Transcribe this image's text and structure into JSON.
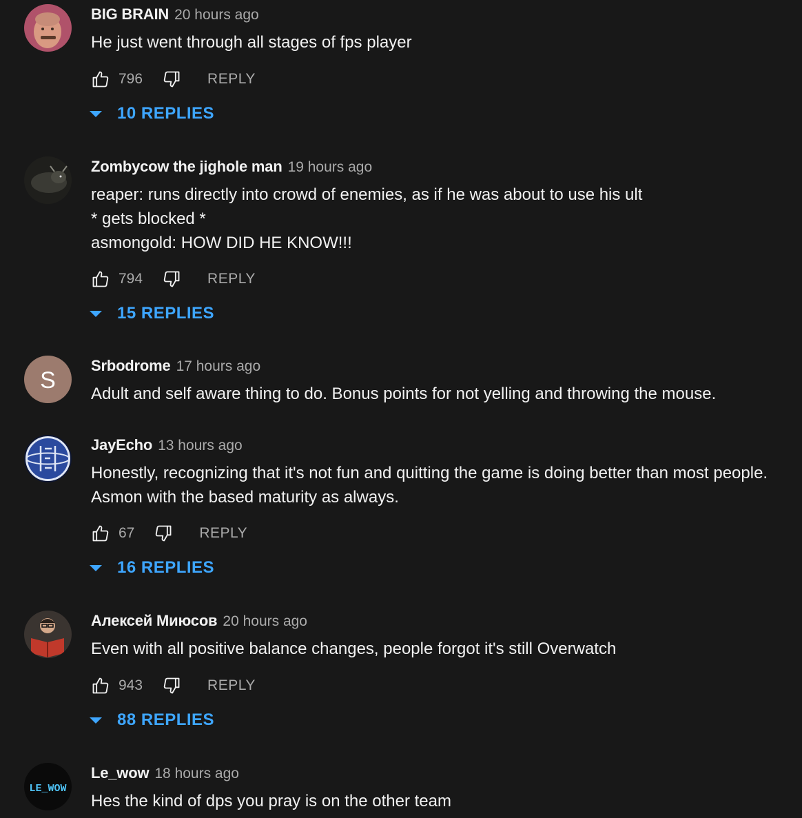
{
  "comments": [
    {
      "author": "BIG BRAIN",
      "time": "20 hours ago",
      "lines": [
        "He just went through all stages of fps player"
      ],
      "likes": "796",
      "reply_label": "REPLY",
      "replies_label": "10 REPLIES",
      "avatar": {
        "type": "face-photo",
        "color": "#b0526a"
      }
    },
    {
      "author": "Zombycow the jighole man",
      "time": "19 hours ago",
      "lines": [
        "reaper: runs directly into crowd of enemies, as if he was about to use his ult",
        "* gets blocked *",
        "asmongold: HOW DID HE KNOW!!!"
      ],
      "likes": "794",
      "reply_label": "REPLY",
      "replies_label": "15 REPLIES",
      "avatar": {
        "type": "cow-photo",
        "color": "#2e2e2a"
      }
    },
    {
      "author": "Srbodrome",
      "time": "17 hours ago",
      "lines": [
        "Adult and self aware thing to do. Bonus points for not yelling and throwing the mouse."
      ],
      "avatar": {
        "type": "letter",
        "letter": "S",
        "color": "#9c7b6e"
      }
    },
    {
      "author": "JayEcho",
      "time": "13 hours ago",
      "lines": [
        "Honestly, recognizing that it's not fun and quitting the game is doing better than most people.",
        "Asmon with the based maturity as always."
      ],
      "likes": "67",
      "reply_label": "REPLY",
      "replies_label": "16 REPLIES",
      "avatar": {
        "type": "logo-globe",
        "color": "#2b4a9e"
      }
    },
    {
      "author": "Алексей Миюсов",
      "time": "20 hours ago",
      "lines": [
        "Even with all positive balance changes, people forgot it's still Overwatch"
      ],
      "likes": "943",
      "reply_label": "REPLY",
      "replies_label": "88 REPLIES",
      "avatar": {
        "type": "reader-photo",
        "color": "#c0392b"
      }
    },
    {
      "author": "Le_wow",
      "time": "18 hours ago",
      "lines": [
        "Hes the kind of dps you pray is on the other team"
      ],
      "avatar": {
        "type": "text-logo",
        "text": "LE_WOW",
        "color": "#4fc3f7"
      }
    }
  ],
  "colors": {
    "background": "#181818",
    "text": "#f1f1f1",
    "muted": "#aaaaaa",
    "link": "#3ea6ff"
  },
  "icons": [
    "thumbs-up-icon",
    "thumbs-down-icon",
    "caret-down-icon"
  ]
}
